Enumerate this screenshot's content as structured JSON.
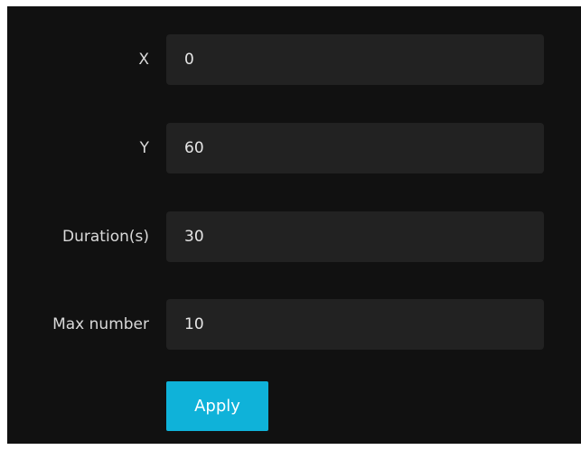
{
  "form": {
    "fields": [
      {
        "label": "X",
        "value": "0"
      },
      {
        "label": "Y",
        "value": "60"
      },
      {
        "label": "Duration(s)",
        "value": "30"
      },
      {
        "label": "Max number",
        "value": "10"
      }
    ],
    "apply_label": "Apply"
  },
  "colors": {
    "panel_background": "#111111",
    "input_background": "#222222",
    "label_text": "#d9d9d9",
    "accent": "#0fb2d9"
  }
}
